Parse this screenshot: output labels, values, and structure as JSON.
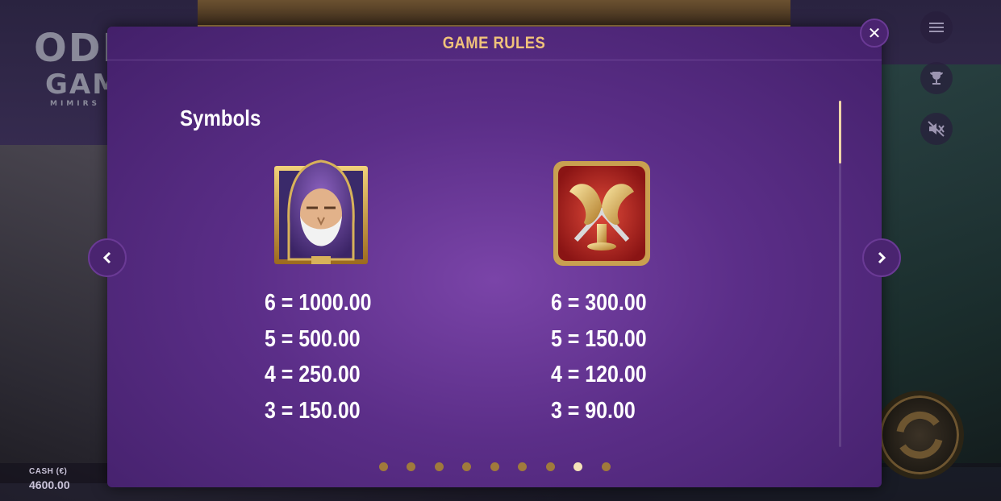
{
  "background": {
    "logo_line1": "ODI",
    "logo_line2": "GAM",
    "logo_line3": "MIMIRS",
    "cash_label": "CASH (€)",
    "cash_value": "4600.00"
  },
  "modal": {
    "title": "GAME RULES",
    "section_title": "Symbols",
    "symbols": [
      {
        "icon": "odin-hooded-wizard-symbol",
        "pays": [
          "6 = 1000.00",
          "5 = 500.00",
          "4 = 250.00",
          "3 = 150.00"
        ]
      },
      {
        "icon": "golden-drinking-horns-symbol",
        "pays": [
          "6 = 300.00",
          "5 = 150.00",
          "4 = 120.00",
          "3 = 90.00"
        ]
      }
    ],
    "pagination": {
      "total": 9,
      "active_index": 7
    }
  },
  "colors": {
    "title_gold": "#f0c27a",
    "modal_purple": "#5b2e88",
    "dot_gold": "#a07a3c",
    "dot_active": "#f5e3b8"
  },
  "icons": {
    "close": "close-icon",
    "prev": "chevron-left-icon",
    "next": "chevron-right-icon",
    "menu": "menu-icon",
    "trophy": "trophy-icon",
    "sound": "sound-muted-icon",
    "spin": "spin-icon"
  }
}
